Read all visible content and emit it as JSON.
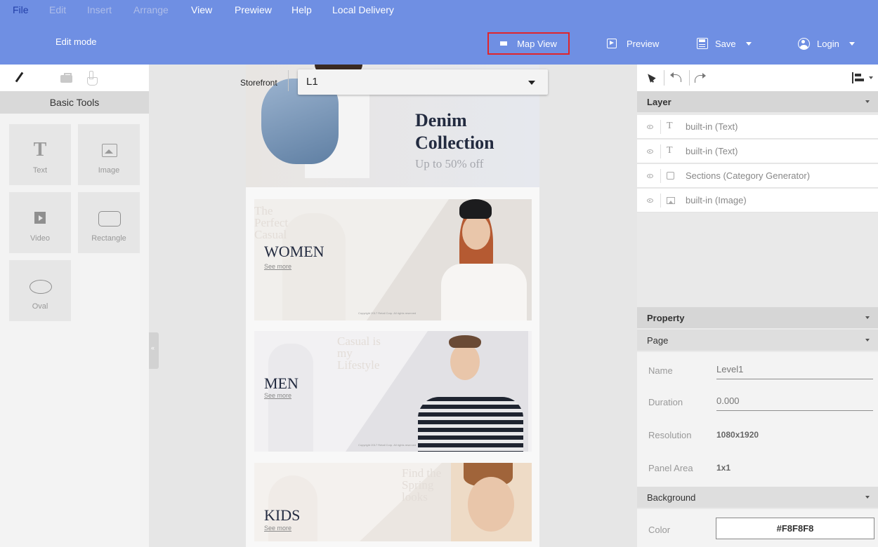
{
  "menu": [
    "File",
    "Edit",
    "Insert",
    "Arrange",
    "View",
    "Prewiew",
    "Help",
    "Local Delivery"
  ],
  "toolbar": {
    "edit_mode": "Edit mode",
    "map_view": "Map View",
    "preview": "Preview",
    "save": "Save",
    "login": "Login"
  },
  "left_panel": {
    "section": "Basic Tools",
    "tools": [
      "Text",
      "Image",
      "Video",
      "Rectangle",
      "Oval"
    ],
    "collapse_glyph": "«"
  },
  "canvas": {
    "storefront_label": "Storefront",
    "level": "L1",
    "hero_title": "Denim Collection",
    "hero_subtitle": "Up to 50% off",
    "banners": [
      {
        "ghost": "The Perfect Casual",
        "category": "WOMEN",
        "see_more": "See more",
        "fine": "Copyright 2017 Retail Corp. All rights reserved"
      },
      {
        "ghost": "Casual is my Lifestyle",
        "category": "MEN",
        "see_more": "See more",
        "fine": "Copyright 2017 Retail Corp. All rights reserved"
      },
      {
        "ghost": "Find the Spring looks",
        "category": "KIDS",
        "see_more": "See more"
      }
    ]
  },
  "right_panel": {
    "layer_header": "Layer",
    "layers": [
      {
        "type": "T",
        "name": "built-in (Text)"
      },
      {
        "type": "T",
        "name": "built-in (Text)"
      },
      {
        "type": "section",
        "name": "Sections (Category Generator)"
      },
      {
        "type": "image",
        "name": "built-in (Image)"
      }
    ],
    "property_header": "Property",
    "page_header": "Page",
    "properties": {
      "name_label": "Name",
      "name_value": "Level1",
      "duration_label": "Duration",
      "duration_value": "0.000",
      "resolution_label": "Resolution",
      "resolution_value": "1080x1920",
      "panel_label": "Panel Area",
      "panel_value": "1x1"
    },
    "background_header": "Background",
    "color_label": "Color",
    "color_value": "#F8F8F8"
  },
  "colors": {
    "menubar": "#6f8fe3",
    "highlight_border": "#e0242b",
    "canvas_bg": "#f8f8f8"
  }
}
